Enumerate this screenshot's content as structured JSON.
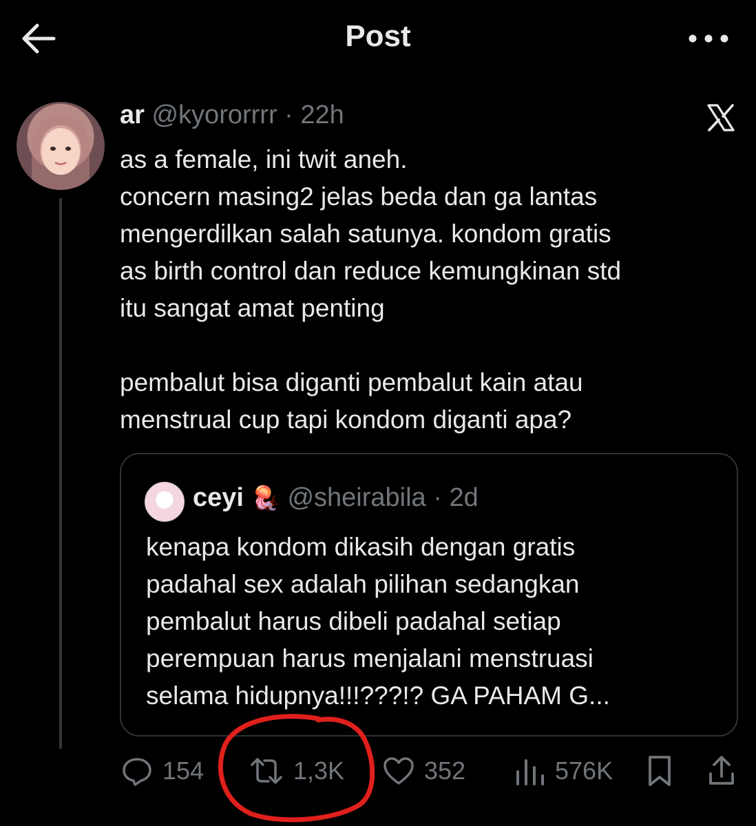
{
  "header": {
    "title": "Post",
    "back_icon": "arrow-left-icon",
    "more_icon": "more-horizontal-icon"
  },
  "post": {
    "author_name": "ar",
    "author_handle": "@kyororrrr",
    "separator": " · ",
    "time": "22h",
    "platform_icon": "x-logo-icon",
    "body_lines_1": [
      "as a female, ini twit aneh.",
      "concern masing2 jelas beda dan ga lantas",
      "mengerdilkan salah satunya. kondom gratis",
      "as birth control dan reduce kemungkinan std",
      "itu sangat amat penting"
    ],
    "body_lines_2": [
      "pembalut bisa diganti pembalut kain atau",
      "menstrual cup tapi kondom diganti apa?"
    ]
  },
  "quote": {
    "author_name": "ceyi",
    "emoji": "🪼",
    "author_handle": "@sheirabila",
    "separator": " · ",
    "time": "2d",
    "body_lines": [
      "kenapa kondom dikasih dengan gratis",
      "padahal sex adalah pilihan sedangkan",
      "pembalut harus dibeli padahal setiap",
      "perempuan harus menjalani menstruasi",
      "selama hidupnya!!!???!? GA PAHAM G..."
    ]
  },
  "actions": {
    "replies": "154",
    "reposts": "1,3K",
    "likes": "352",
    "views": "576K"
  },
  "annotation_color": "#e0201c"
}
